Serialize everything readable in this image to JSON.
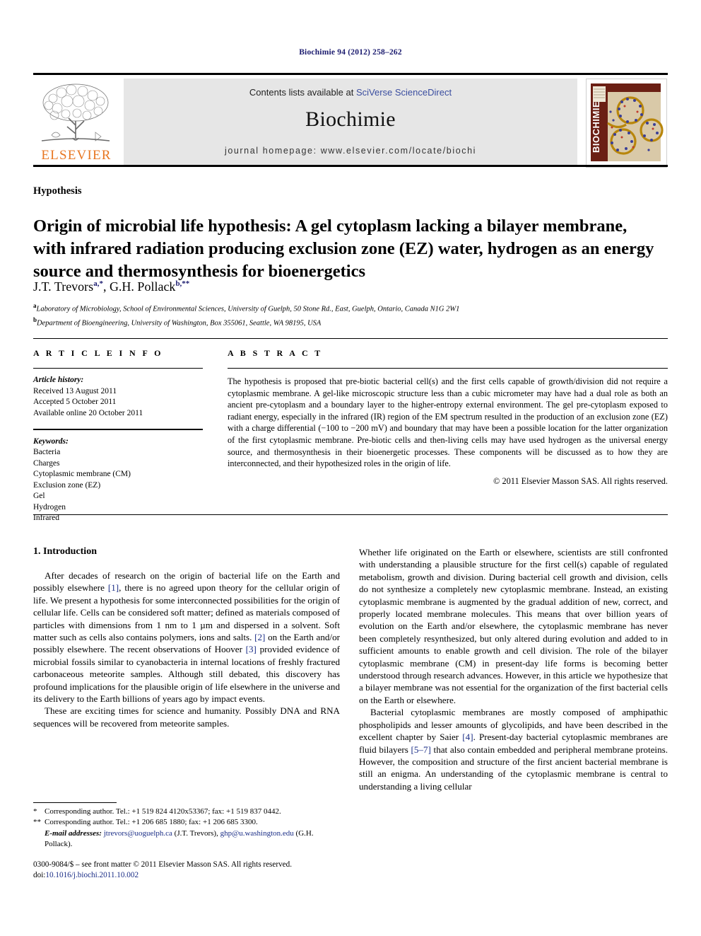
{
  "running_head": "Biochimie 94 (2012) 258–262",
  "masthead": {
    "contents_prefix": "Contents lists available at ",
    "contents_link": "SciVerse ScienceDirect",
    "journal_name": "Biochimie",
    "homepage": "journal homepage: www.elsevier.com/locate/biochi",
    "publisher_wordmark": "ELSEVIER",
    "cover_spine_text": "BIOCHIMIE"
  },
  "article": {
    "type": "Hypothesis",
    "title": "Origin of microbial life hypothesis: A gel cytoplasm lacking a bilayer membrane, with infrared radiation producing exclusion zone (EZ) water, hydrogen as an energy source and thermosynthesis for bioenergetics",
    "authors": [
      {
        "name": "J.T. Trevors",
        "marks": "a,*"
      },
      {
        "name": "G.H. Pollack",
        "marks": "b,**"
      }
    ],
    "affiliations": [
      {
        "mark": "a",
        "text": "Laboratory of Microbiology, School of Environmental Sciences, University of Guelph, 50 Stone Rd., East, Guelph, Ontario, Canada N1G 2W1"
      },
      {
        "mark": "b",
        "text": "Department of Bioengineering, University of Washington, Box 355061, Seattle, WA 98195, USA"
      }
    ]
  },
  "article_info": {
    "heading": "A R T I C L E   I N F O",
    "history_label": "Article history:",
    "history": [
      "Received 13 August 2011",
      "Accepted 5 October 2011",
      "Available online 20 October 2011"
    ],
    "keywords_label": "Keywords:",
    "keywords": [
      "Bacteria",
      "Charges",
      "Cytoplasmic membrane (CM)",
      "Exclusion zone (EZ)",
      "Gel",
      "Hydrogen",
      "Infrared"
    ]
  },
  "abstract": {
    "heading": "A B S T R A C T",
    "text": "The hypothesis is proposed that pre-biotic bacterial cell(s) and the first cells capable of growth/division did not require a cytoplasmic membrane. A gel-like microscopic structure less than a cubic micrometer may have had a dual role as both an ancient pre-cytoplasm and a boundary layer to the higher-entropy external environment. The gel pre-cytoplasm exposed to radiant energy, especially in the infrared (IR) region of the EM spectrum resulted in the production of an exclusion zone (EZ) with a charge differential (−100 to −200 mV) and boundary that may have been a possible location for the latter organization of the first cytoplasmic membrane. Pre-biotic cells and then-living cells may have used hydrogen as the universal energy source, and thermosynthesis in their bioenergetic processes. These components will be discussed as to how they are interconnected, and their hypothesized roles in the origin of life.",
    "copyright": "© 2011 Elsevier Masson SAS. All rights reserved."
  },
  "body": {
    "section_heading": "1. Introduction",
    "left_paragraphs": [
      {
        "segments": [
          {
            "t": "After decades of research on the origin of bacterial life on the Earth and possibly elsewhere "
          },
          {
            "t": "[1]",
            "ref": true
          },
          {
            "t": ", there is no agreed upon theory for the cellular origin of life. We present a hypothesis for some interconnected possibilities for the origin of cellular life. Cells can be considered soft matter; defined as materials composed of particles with dimensions from 1 nm to 1 µm and dispersed in a solvent. Soft matter such as cells also contains polymers, ions and salts. "
          },
          {
            "t": "[2]",
            "ref": true
          },
          {
            "t": " on the Earth and/or possibly elsewhere. The recent observations of Hoover "
          },
          {
            "t": "[3]",
            "ref": true
          },
          {
            "t": " provided evidence of microbial fossils similar to cyanobacteria in internal locations of freshly fractured carbonaceous meteorite samples. Although still debated, this discovery has profound implications for the plausible origin of life elsewhere in the universe and its delivery to the Earth billions of years ago by impact events."
          }
        ]
      },
      {
        "segments": [
          {
            "t": "These are exciting times for science and humanity. Possibly DNA and RNA sequences will be recovered from meteorite samples."
          }
        ]
      }
    ],
    "right_paragraphs": [
      {
        "segments": [
          {
            "t": "Whether life originated on the Earth or elsewhere, scientists are still confronted with understanding a plausible structure for the first cell(s) capable of regulated metabolism, growth and division. During bacterial cell growth and division, cells do not synthesize a completely new cytoplasmic membrane. Instead, an existing cytoplasmic membrane is augmented by the gradual addition of new, correct, and properly located membrane molecules. This means that over billion years of evolution on the Earth and/or elsewhere, the cytoplasmic membrane has never been completely resynthesized, but only altered during evolution and added to in sufficient amounts to enable growth and cell division. The role of the bilayer cytoplasmic membrane (CM) in present-day life forms is becoming better understood through research advances. However, in this article we hypothesize that a bilayer membrane was not essential for the organization of the first bacterial cells on the Earth or elsewhere."
          }
        ],
        "no_indent_first": true
      },
      {
        "segments": [
          {
            "t": "Bacterial cytoplasmic membranes are mostly composed of amphipathic phospholipids and lesser amounts of glycolipids, and have been described in the excellent chapter by Saier "
          },
          {
            "t": "[4]",
            "ref": true
          },
          {
            "t": ". Present-day bacterial cytoplasmic membranes are fluid bilayers "
          },
          {
            "t": "[5–7]",
            "ref": true
          },
          {
            "t": " that also contain embedded and peripheral membrane proteins. However, the composition and structure of the first ancient bacterial membrane is still an enigma. An understanding of the cytoplasmic membrane is central to understanding a living cellular"
          }
        ]
      }
    ]
  },
  "footnotes": {
    "corresponding_1": "Corresponding author. Tel.: +1 519 824 4120x53367; fax: +1 519 837 0442.",
    "corresponding_1_mark": "*",
    "corresponding_2": "Corresponding author. Tel.: +1 206 685 1880; fax: +1 206 685 3300.",
    "corresponding_2_mark": "**",
    "email_label": "E-mail addresses:",
    "email_1": "jtrevors@uoguelph.ca",
    "email_1_owner": "(J.T. Trevors)",
    "email_2": "ghp@u.washington.edu",
    "email_2_owner": "(G.H. Pollack)."
  },
  "footer": {
    "issn_line": "0300-9084/$ – see front matter © 2011 Elsevier Masson SAS. All rights reserved.",
    "doi_label": "doi:",
    "doi_value": "10.1016/j.biochi.2011.10.002"
  },
  "colors": {
    "link_blue": "#3b4ea0",
    "ref_blue": "#1a2d86",
    "elsevier_orange": "#E87722",
    "band_gray": "#e6e6e6",
    "cover_maroon": "#6b1f14"
  }
}
